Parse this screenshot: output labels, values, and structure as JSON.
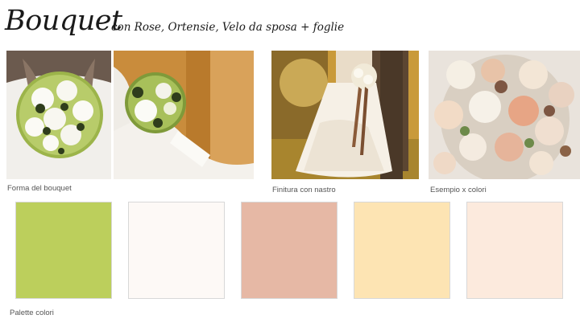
{
  "header": {
    "title": "Bouquet",
    "subtitle": "con Rose, Ortensie, Velo da sposa + foglie"
  },
  "photos": [
    {
      "name": "bouquet-shape-photo",
      "caption": "Forma del bouquet"
    },
    {
      "name": "bouquet-detail-photo",
      "caption": ""
    },
    {
      "name": "ribbon-finish-photo",
      "caption": "Finitura con nastro"
    },
    {
      "name": "color-example-photo",
      "caption": "Esempio  x colori"
    }
  ],
  "palette": {
    "label": "Palette colori",
    "colors": [
      "#bccf5c",
      "#fdf9f6",
      "#e6b8a5",
      "#fde4b3",
      "#fceadd"
    ]
  }
}
